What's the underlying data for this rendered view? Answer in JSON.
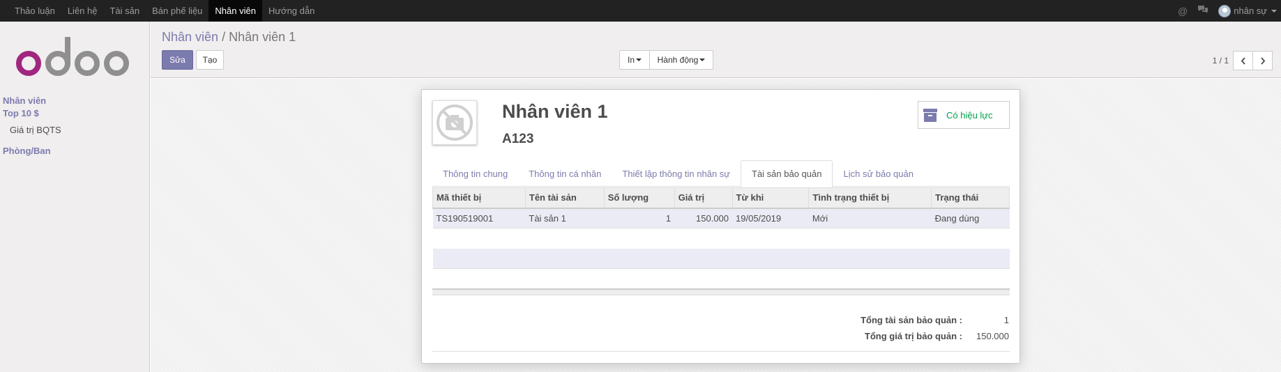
{
  "topnav": {
    "menu": [
      "Thảo luận",
      "Liên hệ",
      "Tài sản",
      "Bán phế liệu",
      "Nhân viên",
      "Hướng dẫn"
    ],
    "active_index": 4,
    "user_label": "nhân sự"
  },
  "sidebar": {
    "section_employees": "Nhân viên",
    "section_top10": "Top 10 $",
    "item_value": "Giá trị BQTS",
    "section_department": "Phòng/Ban"
  },
  "control": {
    "breadcrumb_parent": "Nhân viên",
    "breadcrumb_sep": " / ",
    "breadcrumb_current": "Nhân viên 1",
    "edit_label": "Sửa",
    "create_label": "Tạo",
    "print_label": "In",
    "action_label": "Hành động",
    "pager": "1 / 1"
  },
  "form": {
    "name": "Nhân viên 1",
    "code": "A123",
    "status_label": "Có hiệu lực",
    "tabs": [
      "Thông tin chung",
      "Thông tin cá nhân",
      "Thiết lập thông tin nhân sự",
      "Tài sản bảo quản",
      "Lịch sử bảo quản"
    ],
    "active_tab": 3,
    "table": {
      "headers": [
        "Mã thiết bị",
        "Tên tài sản",
        "Số lượng",
        "Giá trị",
        "Từ khi",
        "Tình trạng thiết bị",
        "Trạng thái"
      ],
      "rows": [
        [
          "TS190519001",
          "Tài sản 1",
          "1",
          "150.000",
          "19/05/2019",
          "Mới",
          "Đang dùng"
        ]
      ]
    },
    "totals": {
      "total_assets_label": "Tổng tài sản bảo quản :",
      "total_assets_value": "1",
      "total_value_label": "Tổng giá trị bảo quản :",
      "total_value_value": "150.000"
    }
  },
  "colors": {
    "brand": "#7c7bad",
    "topbar": "#222222",
    "status_green": "#00a04a",
    "logo_pink": "#a0267f",
    "logo_gray": "#8f8f8f"
  }
}
